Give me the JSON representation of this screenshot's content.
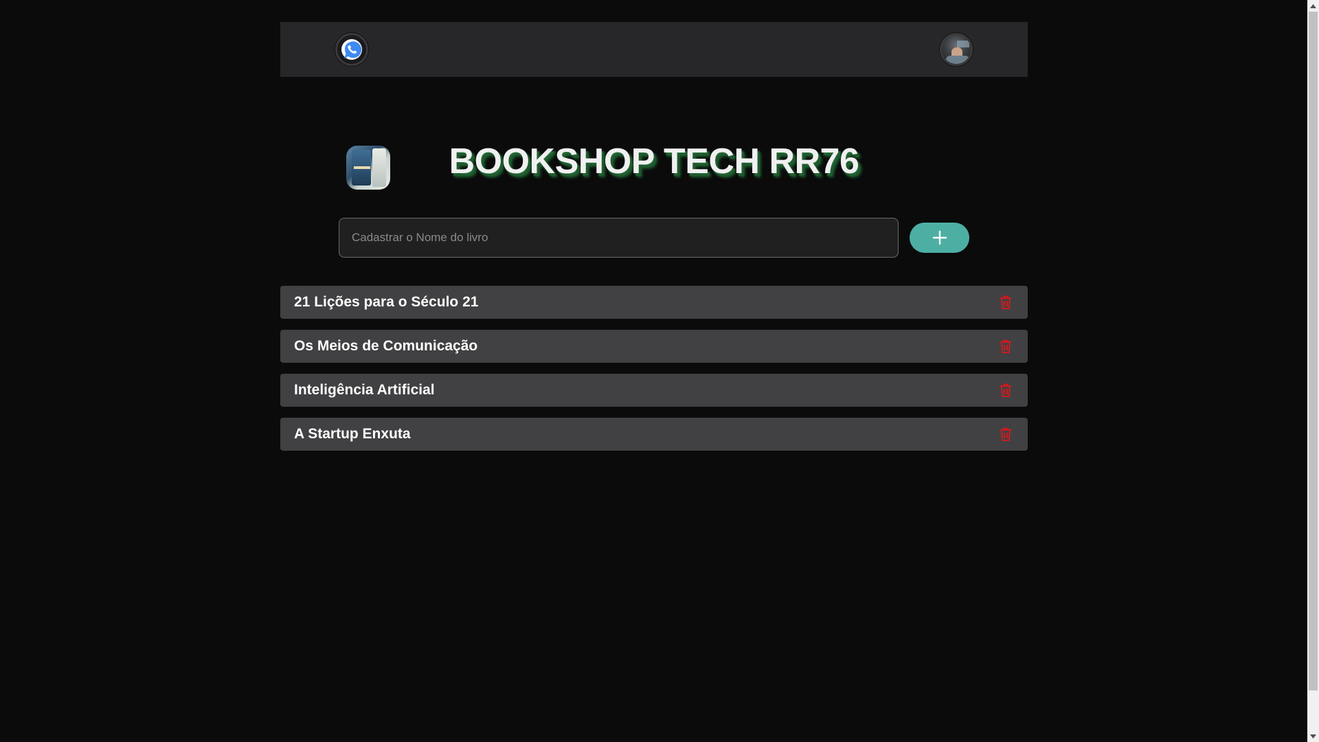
{
  "header": {
    "whatsapp_icon": "whatsapp-icon",
    "profile_icon": "profile-avatar"
  },
  "brand": {
    "title": "BOOKSHOP TECH RR76",
    "title_shadow_color": "#2c7a40"
  },
  "form": {
    "placeholder": "Cadastrar o Nome do livro",
    "value": "",
    "add_icon": "plus-icon",
    "add_color": "#4dafa3"
  },
  "books": [
    {
      "name": "21 Lições para o Século 21"
    },
    {
      "name": "Os Meios de Comunicação"
    },
    {
      "name": "Inteligência Artificial"
    },
    {
      "name": "A Startup Enxuta"
    }
  ],
  "colors": {
    "background": "#0b0b0b",
    "header": "#272729",
    "list_item": "#414143",
    "delete": "#e0161c"
  }
}
